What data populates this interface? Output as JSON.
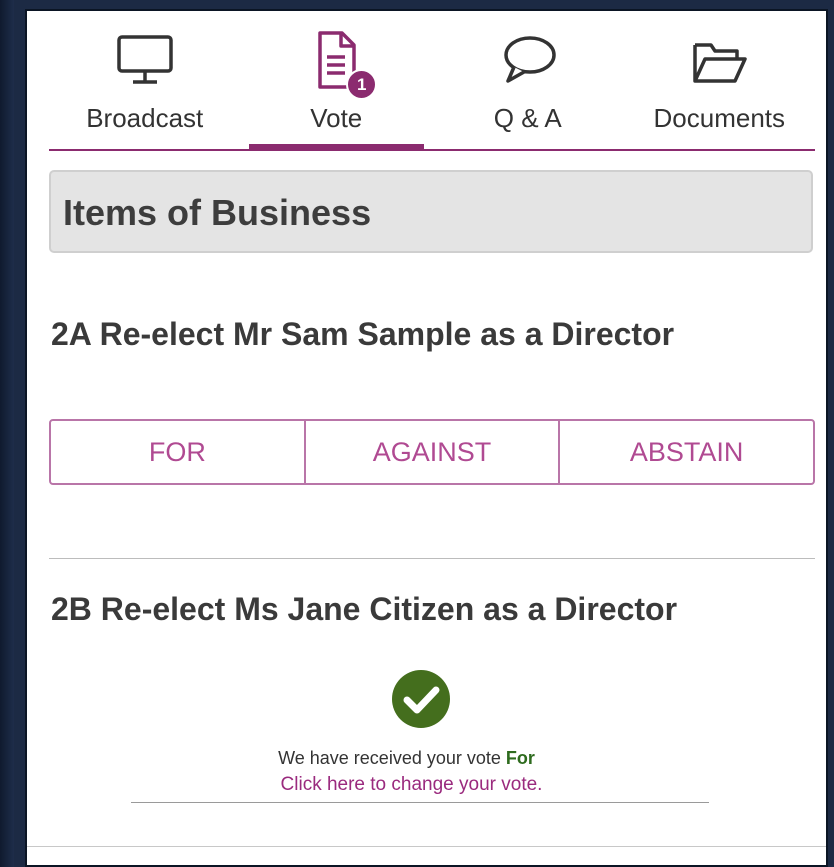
{
  "tabs": [
    {
      "label": "Broadcast",
      "icon": "monitor-icon"
    },
    {
      "label": "Vote",
      "icon": "document-icon",
      "badge": "1",
      "active": true
    },
    {
      "label": "Q & A",
      "icon": "speech-bubble-icon"
    },
    {
      "label": "Documents",
      "icon": "folder-icon"
    }
  ],
  "section": {
    "title": "Items of Business"
  },
  "items": [
    {
      "title": "2A Re-elect Mr Sam Sample as a Director",
      "options": [
        "FOR",
        "AGAINST",
        "ABSTAIN"
      ]
    },
    {
      "title": "2B Re-elect Ms Jane Citizen as a Director",
      "status_icon": "check-circle-icon",
      "received_text": "We have received your vote",
      "vote_choice": "For",
      "change_link": "Click here to change your vote."
    }
  ],
  "colors": {
    "accent": "#8b2b6f",
    "button_text": "#b04a92",
    "check_green": "#446e1d",
    "vote_choice": "#2e6b1e"
  }
}
